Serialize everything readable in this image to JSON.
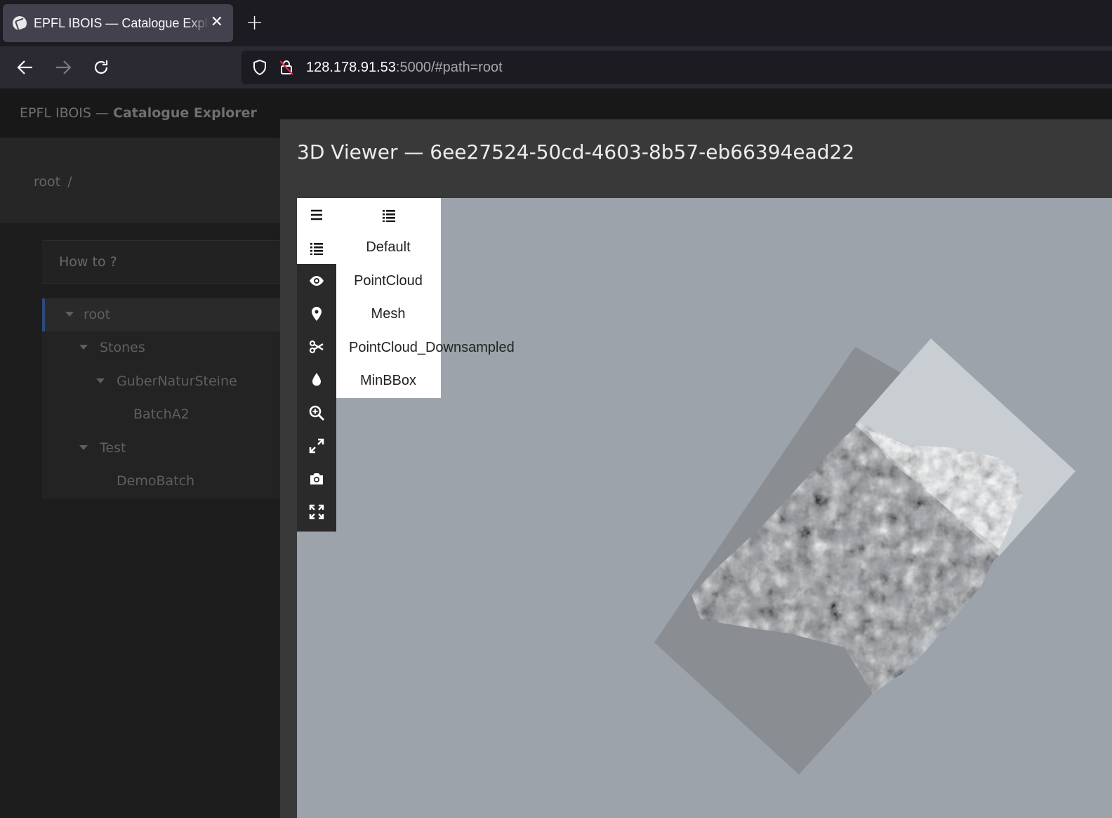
{
  "browser": {
    "tab_title": "EPFL IBOIS — Catalogue Explorer",
    "url_host": "128.178.91.53",
    "url_rest": ":5000/#path=root"
  },
  "app": {
    "brand_prefix": "EPFL IBOIS — ",
    "brand_bold": "Catalogue Explorer"
  },
  "sidebar": {
    "breadcrumb": "root",
    "breadcrumb_sep": "/",
    "howto": "How to ?",
    "tree": [
      {
        "label": "root",
        "level": 0,
        "expandable": true,
        "selected": true
      },
      {
        "label": "Stones",
        "level": 1,
        "expandable": true,
        "selected": false
      },
      {
        "label": "GuberNaturSteine",
        "level": 2,
        "expandable": true,
        "selected": false
      },
      {
        "label": "BatchA2",
        "level": 3,
        "expandable": false,
        "selected": false
      },
      {
        "label": "Test",
        "level": 1,
        "expandable": true,
        "selected": false
      },
      {
        "label": "DemoBatch",
        "level": 2,
        "expandable": false,
        "selected": false
      }
    ]
  },
  "viewer": {
    "title": "3D Viewer — 6ee27524-50cd-4603-8b57-eb66394ead22",
    "tools": [
      "menu-icon",
      "layers-icon",
      "eye-icon",
      "map-marker-icon",
      "scissors-icon",
      "droplet-icon",
      "zoom-in-icon",
      "expand-icon",
      "camera-icon",
      "fullscreen-icon"
    ],
    "layers": [
      "Default",
      "PointCloud",
      "Mesh",
      "PointCloud_Downsampled",
      "MinBBox"
    ]
  },
  "colors": {
    "canvas_bg": "#9ca3aa",
    "viewer_bg": "#393939",
    "sidebar_bg": "#1d1d1d",
    "accent": "#2d4a7a"
  }
}
